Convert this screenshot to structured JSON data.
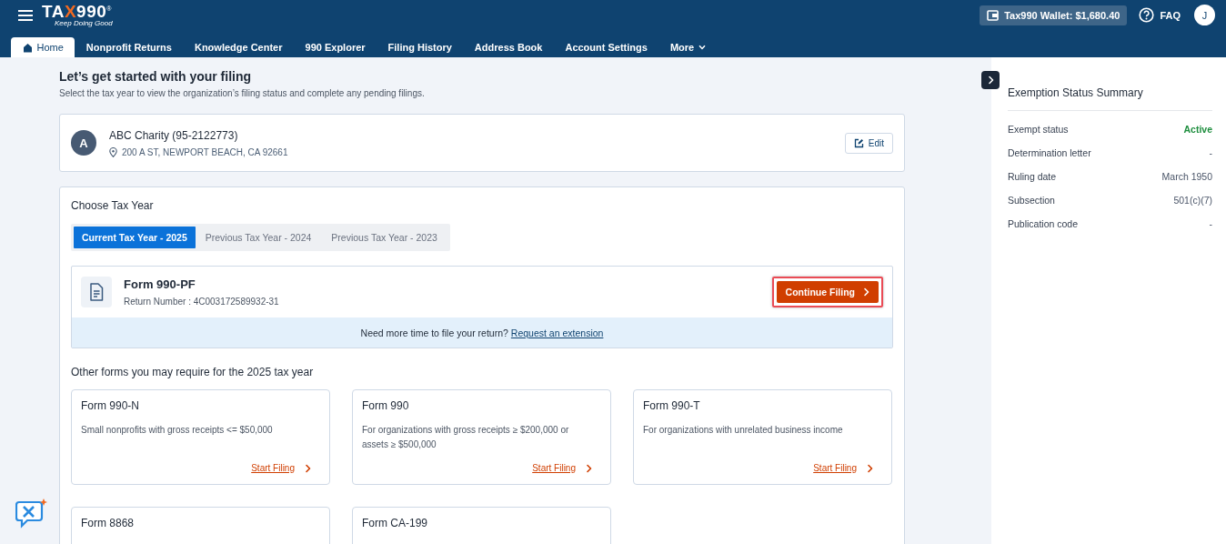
{
  "header": {
    "logo": {
      "parts": [
        {
          "text": "TA",
          "accent": false
        },
        {
          "text": "X",
          "accent": true
        },
        {
          "text": "990",
          "accent": false
        }
      ],
      "mark": "®",
      "tagline": "Keep Doing Good"
    },
    "wallet": "Tax990 Wallet: $1,680.40",
    "faq": "FAQ",
    "avatar": "J"
  },
  "nav": [
    {
      "label": "Home",
      "selected": true,
      "kind": "home"
    },
    {
      "label": "Nonprofit Returns",
      "selected": false,
      "kind": "plain"
    },
    {
      "label": "Knowledge Center",
      "selected": false,
      "kind": "plain"
    },
    {
      "label": "990 Explorer",
      "selected": false,
      "kind": "plain"
    },
    {
      "label": "Filing History",
      "selected": false,
      "kind": "plain"
    },
    {
      "label": "Address Book",
      "selected": false,
      "kind": "plain"
    },
    {
      "label": "Account Settings",
      "selected": false,
      "kind": "plain"
    },
    {
      "label": "More",
      "selected": false,
      "kind": "menu"
    }
  ],
  "intro": {
    "title": "Let’s get started with your filing",
    "subtitle": "Select the tax year to view the organization’s filing status and complete any pending filings."
  },
  "organization": {
    "initial": "A",
    "name": "ABC Charity (95-2122773)",
    "address": "200 A ST, NEWPORT BEACH, CA 92661",
    "edit": "Edit"
  },
  "tax_year": {
    "title": "Choose Tax Year",
    "tabs": [
      {
        "label": "Current Tax Year - 2025",
        "selected": true
      },
      {
        "label": "Previous Tax Year - 2024",
        "selected": false
      },
      {
        "label": "Previous Tax Year - 2023",
        "selected": false
      }
    ],
    "return": {
      "form": "Form 990-PF",
      "number": "Return Number : 4C003172589932-31",
      "button": "Continue Filing",
      "highlighted": true,
      "note": "Need more time to file your return?",
      "link": "Request an extension"
    },
    "other_title": "Other forms you may require for the 2025 tax year",
    "other_forms": [
      {
        "title": "Form 990-N",
        "description": "Small nonprofits with gross receipts <= $50,000",
        "action": "Start Filing"
      },
      {
        "title": "Form 990",
        "description": "For organizations with gross receipts ≥ $200,000 or assets ≥ $500,000",
        "action": "Start Filing"
      },
      {
        "title": "Form 990-T",
        "description": "For organizations with unrelated business income",
        "action": "Start Filing"
      },
      {
        "title": "Form 8868"
      },
      {
        "title": "Form CA-199"
      }
    ]
  },
  "summary": {
    "title": "Exemption Status Summary",
    "rows": [
      {
        "label": "Exempt status",
        "value": "Active",
        "kind": "status"
      },
      {
        "label": "Determination letter",
        "value": "-",
        "kind": "text"
      },
      {
        "label": "Ruling date",
        "value": "March 1950",
        "kind": "text"
      },
      {
        "label": "Subsection",
        "value": "501(c)(7)",
        "kind": "text"
      },
      {
        "label": "Publication code",
        "value": "-",
        "kind": "text"
      }
    ]
  }
}
